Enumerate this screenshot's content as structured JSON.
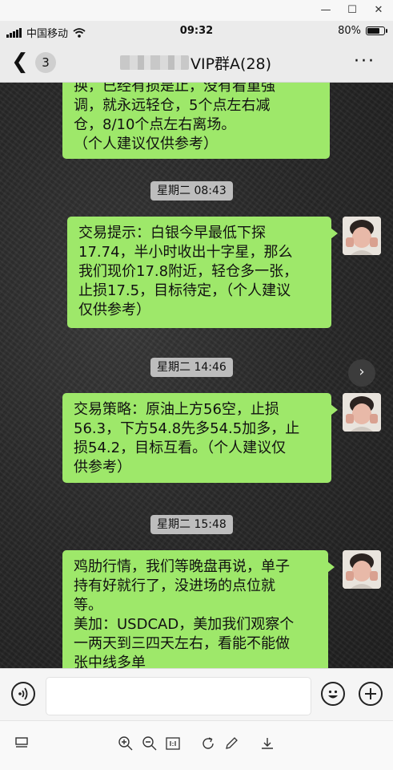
{
  "window": {
    "minimize": "—",
    "maximize": "☐",
    "close": "✕"
  },
  "status": {
    "carrier": "中国移动",
    "time": "09:32",
    "battery": "80%",
    "battery_level": 0.8
  },
  "nav": {
    "unread_count": "3",
    "title": "VIP群A(28)",
    "more": "···"
  },
  "messages": [
    {
      "lines": [
        "换，已经有损是止，没有看重强",
        "调，就永远轻仓，5个点左右减",
        "仓，8/10个点左右离场。",
        "（个人建议仅供参考）"
      ]
    },
    {
      "lines": [
        "交易提示：白银今早最低下探",
        "17.74，半小时收出十字星，那么",
        "我们现价17.8附近，轻仓多一张，",
        "止损17.5，目标待定，（个人建议",
        "仅供参考）"
      ]
    },
    {
      "lines": [
        "交易策略：原油上方56空，止损",
        "56.3，下方54.8先多54.5加多，止",
        "损54.2，目标互看。（个人建议仅",
        "供参考）"
      ]
    },
    {
      "lines": [
        "鸡肋行情，我们等晚盘再说，单子",
        "持有好就行了，没进场的点位就",
        "等。",
        "美加：USDCAD，美加我们观察个",
        "一两天到三四天左右，看能不能做",
        "张中线多单"
      ]
    }
  ],
  "timestamps": [
    "星期二 08:43",
    "星期二 14:46",
    "星期二 15:48"
  ],
  "icons": {
    "back": "chevron-left-icon",
    "voice": "voice-icon",
    "emoji": "emoji-icon",
    "add": "plus-icon",
    "next": "chevron-right-icon"
  },
  "colors": {
    "bubble": "#9ee86a",
    "stamp": "#bdbdbd"
  }
}
